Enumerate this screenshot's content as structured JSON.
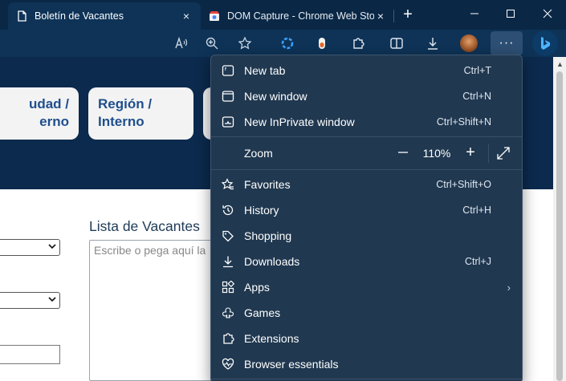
{
  "tabs": [
    {
      "title": "Boletín de Vacantes",
      "active": true,
      "close": "×"
    },
    {
      "title": "DOM Capture - Chrome Web Sto",
      "active": false,
      "close": "×"
    }
  ],
  "tabstrip": {
    "new_tab": "+",
    "minimize": "—",
    "maximize": "☐",
    "close": "✕"
  },
  "toolbar": {
    "icons": [
      "read-aloud-icon",
      "zoom-icon",
      "favorite-star-icon",
      "extension-circle-icon",
      "extension-pill-icon",
      "extensions-puzzle-icon",
      "split-screen-icon",
      "downloads-icon",
      "profile-avatar",
      "settings-more-icon",
      "bing-copilot-icon"
    ],
    "more_label": "···"
  },
  "page": {
    "cards": [
      {
        "line1": "udad /",
        "line2": "erno"
      },
      {
        "line1": "Región /",
        "line2": "Interno"
      }
    ],
    "list_title": "Lista de Vacantes",
    "list_placeholder": "Escribe o pega aquí la"
  },
  "menu": {
    "items": [
      {
        "label": "New tab",
        "shortcut": "Ctrl+T",
        "icon": "new-tab-icon"
      },
      {
        "label": "New window",
        "shortcut": "Ctrl+N",
        "icon": "new-window-icon"
      },
      {
        "label": "New InPrivate window",
        "shortcut": "Ctrl+Shift+N",
        "icon": "inprivate-icon"
      },
      {
        "label": "Favorites",
        "shortcut": "Ctrl+Shift+O",
        "icon": "favorites-icon"
      },
      {
        "label": "History",
        "shortcut": "Ctrl+H",
        "icon": "history-icon"
      },
      {
        "label": "Shopping",
        "shortcut": "",
        "icon": "shopping-tag-icon"
      },
      {
        "label": "Downloads",
        "shortcut": "Ctrl+J",
        "icon": "downloads-icon"
      },
      {
        "label": "Apps",
        "shortcut": "",
        "icon": "apps-icon",
        "submenu": "›"
      },
      {
        "label": "Games",
        "shortcut": "",
        "icon": "games-icon"
      },
      {
        "label": "Extensions",
        "shortcut": "",
        "icon": "extensions-icon"
      },
      {
        "label": "Browser essentials",
        "shortcut": "",
        "icon": "browser-essentials-icon"
      }
    ],
    "zoom": {
      "label": "Zoom",
      "minus": "—",
      "value": "110%",
      "plus": "+"
    }
  },
  "colors": {
    "tabstrip_bg": "#0a2846",
    "toolbar_bg": "#0e3357",
    "menu_bg": "#203850",
    "card_text": "#1f4f8c"
  }
}
